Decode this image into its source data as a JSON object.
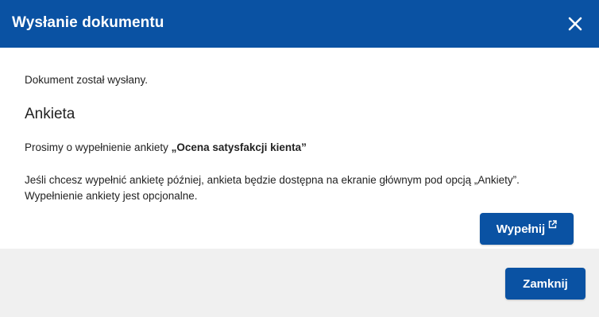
{
  "dialog": {
    "title": "Wysłanie dokumentu",
    "close_icon": "close-icon"
  },
  "content": {
    "message": "Dokument został wysłany.",
    "heading": "Ankieta",
    "request_prefix": "Prosimy o wypełnienie ankiety ",
    "survey_name": "„Ocena satysfakcji kienta”",
    "info_line1": "Jeśli chcesz wypełnić ankietę później, ankieta będzie dostępna na ekranie głównym pod opcją „Ankiety”.",
    "info_line2": "Wypełnienie ankiety jest opcjonalne.",
    "fill_button_label": "Wypełnij",
    "fill_button_icon": "external-link-icon"
  },
  "footer": {
    "close_button_label": "Zamknij"
  },
  "colors": {
    "primary": "#0a52a3",
    "footer_bg": "#f0f0f0",
    "text": "#222222"
  }
}
